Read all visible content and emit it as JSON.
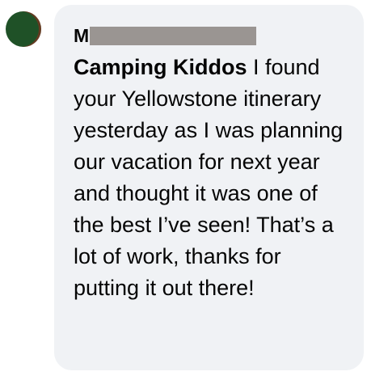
{
  "comment": {
    "author_initial": "M",
    "mention": "Camping Kiddos",
    "body": " I found your Yellowstone itinerary yesterday as I was planning our vacation for next year and thought it was one of the best I’ve seen! That’s a lot of work, thanks for putting it out there!"
  },
  "colors": {
    "bubble_background": "#f0f2f5",
    "avatar": "#1f5127",
    "redaction": "#9a9592",
    "text": "#050505"
  }
}
